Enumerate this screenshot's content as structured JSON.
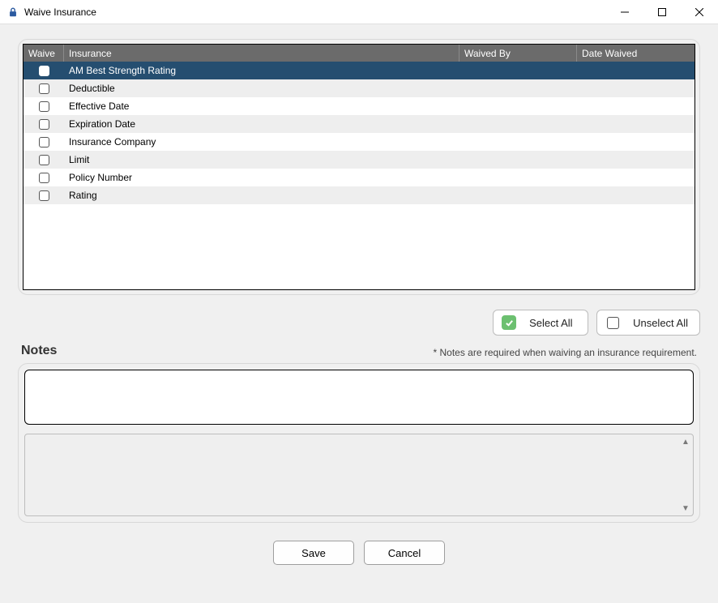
{
  "window": {
    "title": "Waive Insurance"
  },
  "table": {
    "headers": {
      "waive": "Waive",
      "insurance": "Insurance",
      "waived_by": "Waived By",
      "date_waived": "Date Waived"
    },
    "rows": [
      {
        "insurance": "AM Best Strength Rating",
        "waived_by": "",
        "date_waived": "",
        "checked": false,
        "selected": true
      },
      {
        "insurance": "Deductible",
        "waived_by": "",
        "date_waived": "",
        "checked": false,
        "selected": false
      },
      {
        "insurance": "Effective Date",
        "waived_by": "",
        "date_waived": "",
        "checked": false,
        "selected": false
      },
      {
        "insurance": "Expiration Date",
        "waived_by": "",
        "date_waived": "",
        "checked": false,
        "selected": false
      },
      {
        "insurance": "Insurance Company",
        "waived_by": "",
        "date_waived": "",
        "checked": false,
        "selected": false
      },
      {
        "insurance": "Limit",
        "waived_by": "",
        "date_waived": "",
        "checked": false,
        "selected": false
      },
      {
        "insurance": "Policy Number",
        "waived_by": "",
        "date_waived": "",
        "checked": false,
        "selected": false
      },
      {
        "insurance": "Rating",
        "waived_by": "",
        "date_waived": "",
        "checked": false,
        "selected": false
      }
    ]
  },
  "buttons": {
    "select_all": "Select All",
    "unselect_all": "Unselect All",
    "save": "Save",
    "cancel": "Cancel"
  },
  "notes": {
    "title": "Notes",
    "hint": "* Notes are required when waiving an insurance requirement.",
    "value": ""
  }
}
